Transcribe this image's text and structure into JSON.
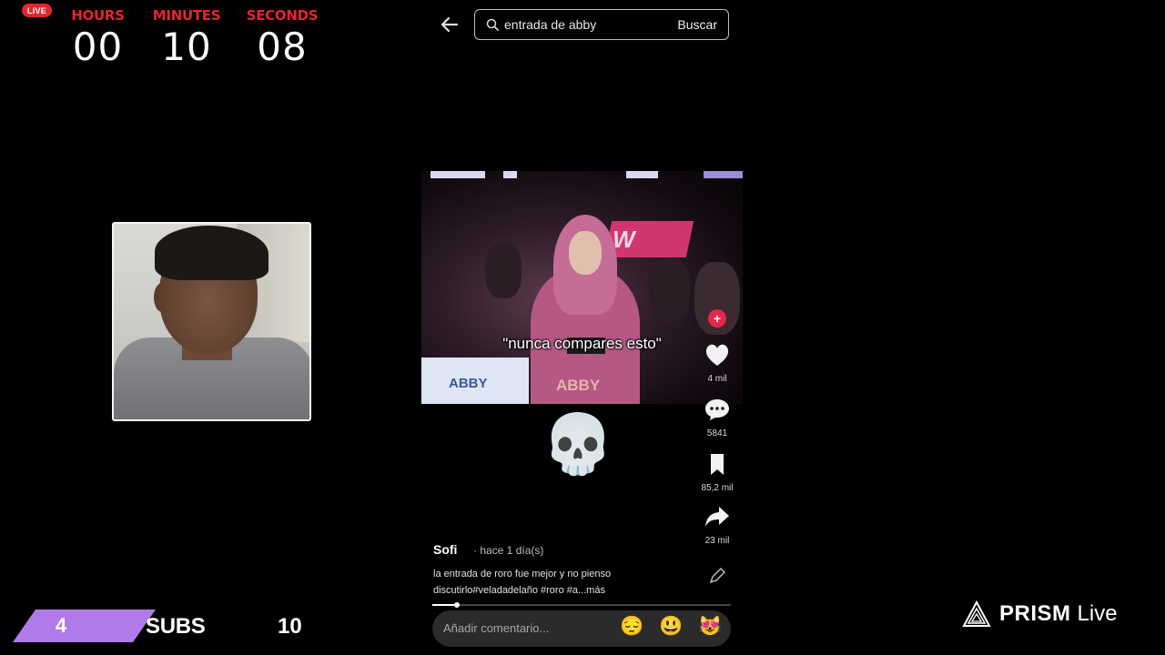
{
  "stream": {
    "live_badge": "LIVE",
    "countdown": {
      "hours_label": "HOURS",
      "hours": "00",
      "minutes_label": "MINUTES",
      "minutes": "10",
      "seconds_label": "SECONDS",
      "seconds": "08"
    },
    "subs_goal": {
      "current": "4",
      "label": "SUBS",
      "target": "10",
      "bar_color": "#b07be8",
      "progress_fraction": 0.4
    },
    "brand": {
      "name": "PRISM",
      "suffix": "Live"
    }
  },
  "phone": {
    "search": {
      "query": "entrada de abby",
      "button": "Buscar",
      "icon": "search-icon"
    },
    "video": {
      "caption": "\"nunca compares esto\"",
      "sign_text": "ABBY",
      "sign_text_2": "ABBY",
      "neon_text": "W"
    },
    "actions": {
      "likes": "4 mil",
      "comments": "5841",
      "saves": "85,2 mil",
      "shares": "23 mil"
    },
    "post": {
      "author": "Sofi",
      "time_ago": "· hace 1 día(s)",
      "description_line1": "la entrada de roro fue mejor y no pienso",
      "description_line2": "discutirlo#veladadelaño #roro #a...más"
    },
    "comment": {
      "placeholder": "Añadir comentario...",
      "emojis": [
        "😔",
        "😃",
        "😻"
      ]
    },
    "accent": "#e4284b"
  }
}
